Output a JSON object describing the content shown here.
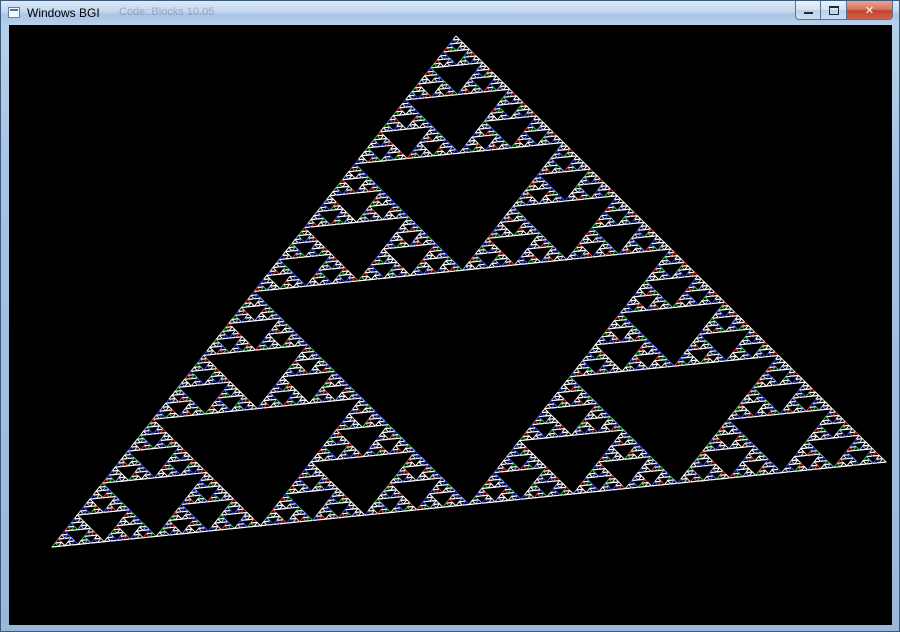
{
  "window": {
    "title": "Windows BGI",
    "background_title_hint": "Code::Blocks 10.05",
    "controls": {
      "minimize_glyph": "minimize-icon",
      "maximize_glyph": "maximize-icon",
      "close_glyph": "✕"
    }
  },
  "canvas": {
    "background": "#000000",
    "fractal": "sierpinski-triangle",
    "depth": 7,
    "palette": [
      "#ffffff",
      "#2a3cd6",
      "#d8d8d8",
      "#3b4fe8",
      "#e03a2a",
      "#2fbf3a",
      "#ffffff",
      "#8fa0ff"
    ]
  }
}
